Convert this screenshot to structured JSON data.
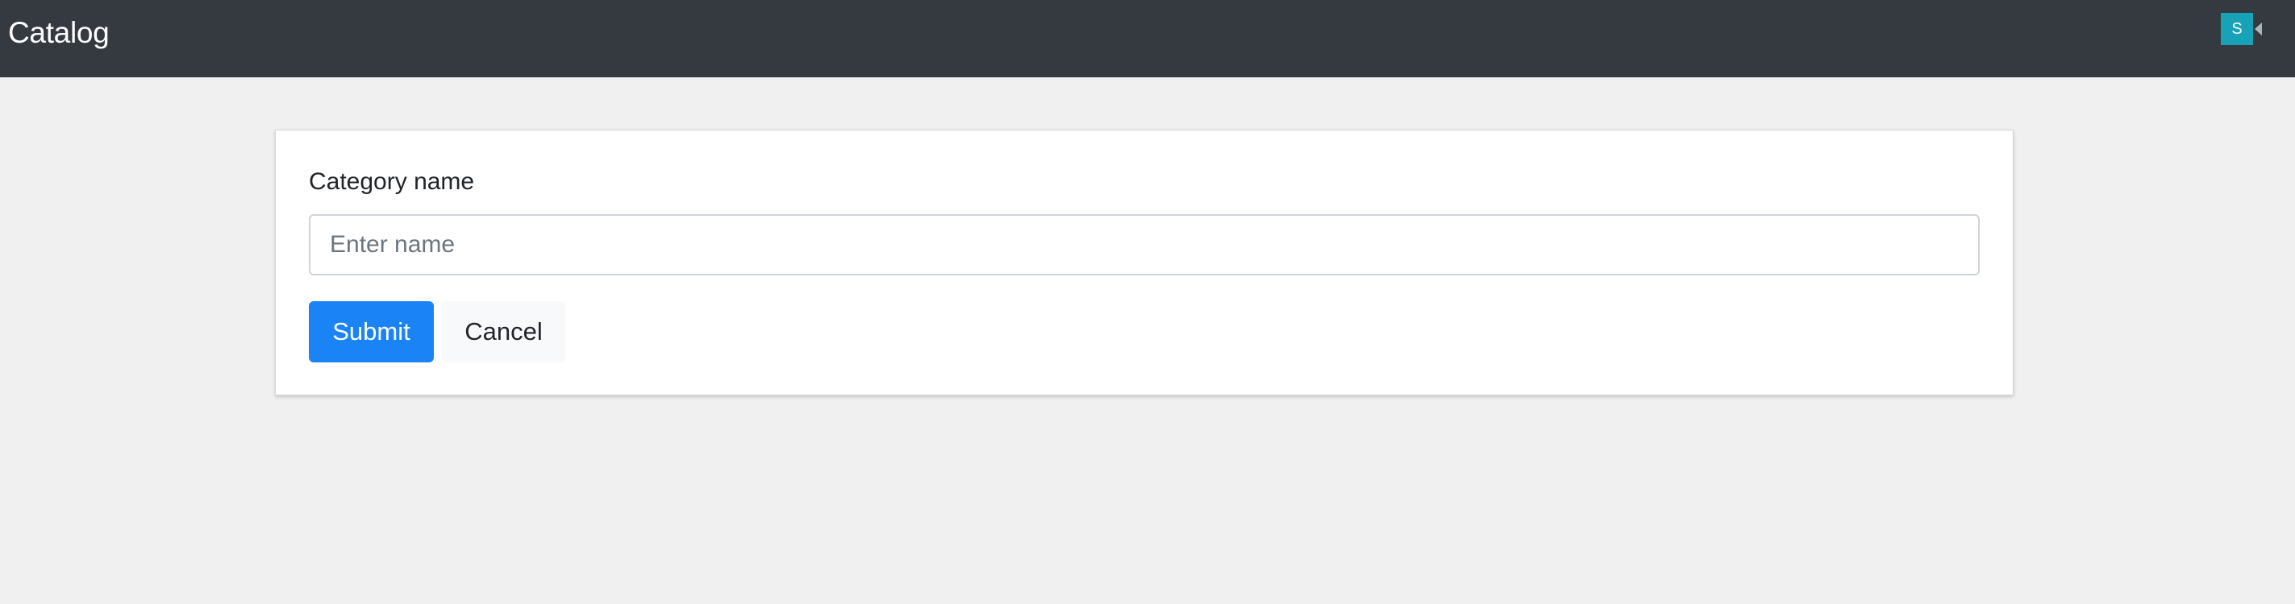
{
  "navbar": {
    "brand": "Catalog",
    "user": {
      "avatar_letter": "S",
      "avatar_color": "#17a2b8"
    }
  },
  "form": {
    "label": "Category name",
    "input": {
      "value": "",
      "placeholder": "Enter name"
    },
    "submit_label": "Submit",
    "cancel_label": "Cancel"
  },
  "colors": {
    "navbar_bg": "#343a40",
    "page_bg": "#f0f0f0",
    "primary": "#1a84f7"
  }
}
